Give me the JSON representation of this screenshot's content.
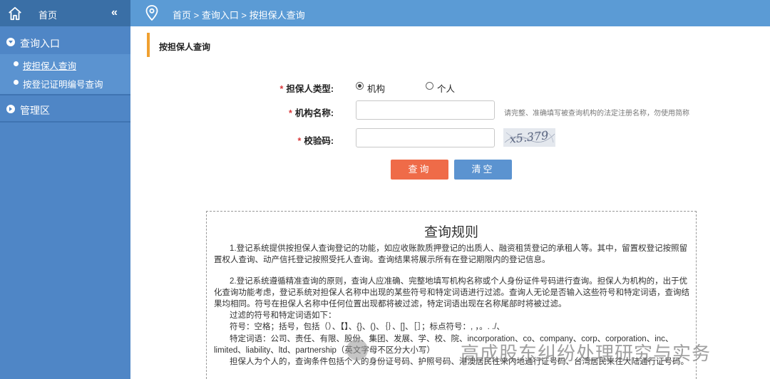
{
  "header": {
    "home_label": "首页",
    "collapse_glyph": "«",
    "breadcrumb": "首页 > 查询入口 > 按担保人查询"
  },
  "sidebar": {
    "groups": [
      {
        "label": "查询入口",
        "expanded": true
      },
      {
        "label": "管理区",
        "expanded": false
      }
    ],
    "items": [
      {
        "label": "按担保人查询",
        "active": true
      },
      {
        "label": "按登记证明编号查询",
        "active": false
      }
    ]
  },
  "page": {
    "title": "按担保人查询"
  },
  "form": {
    "type_label": "担保人类型:",
    "type_options": [
      {
        "label": "机构",
        "checked": true
      },
      {
        "label": "个人",
        "checked": false
      }
    ],
    "org_label": "机构名称:",
    "org_value": "",
    "org_hint": "请完整、准确填写被查询机构的法定注册名称，勿使用简称",
    "code_label": "校验码:",
    "code_value": "",
    "captcha_text": "x5.379",
    "required_mark": "*"
  },
  "buttons": {
    "query": "查询",
    "clear": "清空"
  },
  "rules": {
    "title": "查询规则",
    "p1": "1.登记系统提供按担保人查询登记的功能，如应收账款质押登记的出质人、融资租赁登记的承租人等。其中，留置权登记按照留置权人查询、动产信托登记按照受托人查询。查询结果将展示所有在登记期限内的登记信息。",
    "p2": "2.登记系统遵循精准查询的原则，查询人应准确、完整地填写机构名称或个人身份证件号码进行查询。担保人为机构的，出于优化查询功能考虑，登记系统对担保人名称中出现的某些符号和特定词语进行过滤。查询人无论是否输入这些符号和特定词语，查询结果均相同。符号在担保人名称中任何位置出现都将被过滤，特定词语出现在名称尾部时将被过滤。",
    "p3": "过滤的符号和特定词语如下：",
    "p4": "符号：空格；括号，包括（）、【】、{}、()、｛｝、[]、［］；标点符号：, ，。. ./、",
    "p5": "特定词语：公司、责任、有限、股份、集团、发展、学、校、院、incorporation、co、company、corp、corporation、inc、limited、liability、ltd、partnership（英文字母不区分大小写）",
    "p6": "担保人为个人的，查询条件包括个人的身份证号码、护照号码、港澳居民往来内地通行证号码、台湾居民来往大陆通行证号码。"
  },
  "watermark": {
    "text": "高成股东纠纷处理研究与实务"
  },
  "colors": {
    "topbar": "#5b9bd5",
    "sidebar": "#4f86c6",
    "accent_bar": "#f0a030",
    "query_button": "#ef6b48",
    "clear_button": "#5b93d0",
    "required": "#d9383a"
  }
}
